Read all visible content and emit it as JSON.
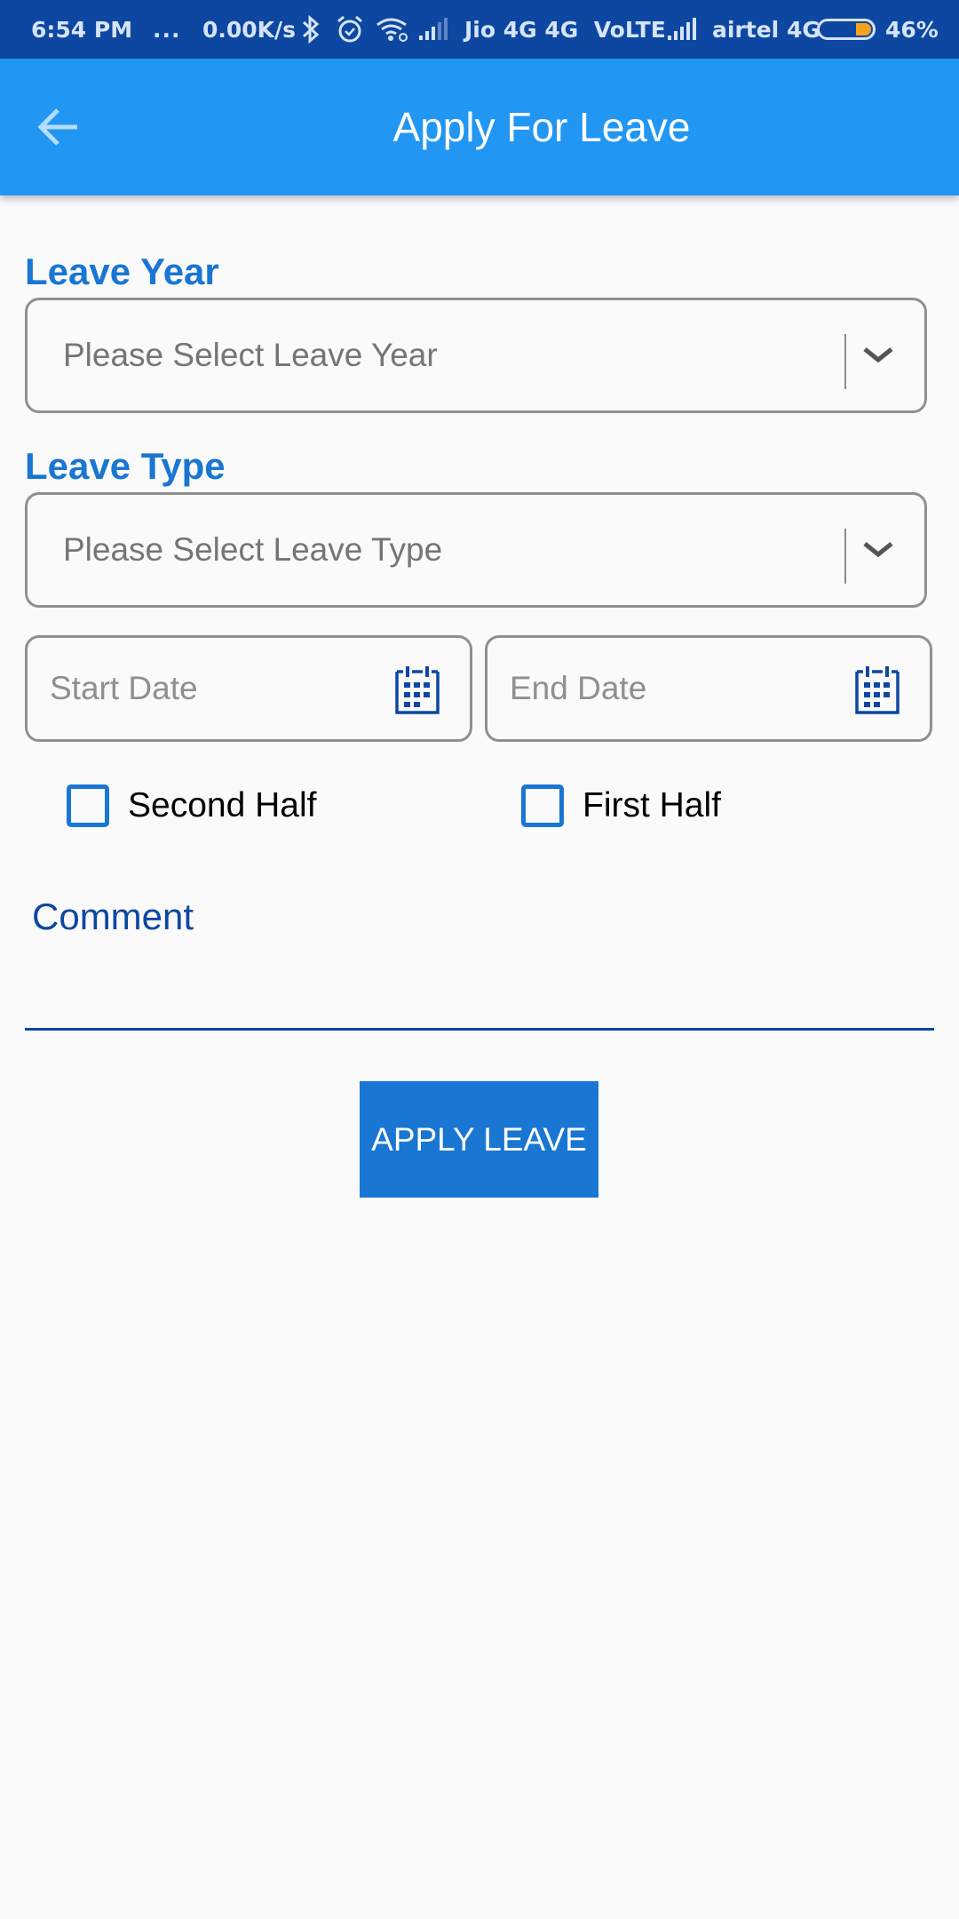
{
  "status_bar": {
    "time": "6:54 PM",
    "notifications": "...",
    "network_speed": "0.00K/s",
    "icons": [
      "bluetooth-icon",
      "alarm-icon",
      "wifi-icon",
      "signal-icon"
    ],
    "carrier1": "Jio 4G 4G  VoLTE",
    "carrier2": "airtel 4G",
    "battery_percent": "46%",
    "battery_level": 0.46,
    "battery_color": "#f7a21b"
  },
  "app_bar": {
    "title": "Apply For Leave",
    "back_icon": "arrow-left-icon",
    "color": "#2196f3"
  },
  "form": {
    "leave_year": {
      "label": "Leave Year",
      "placeholder": "Please Select Leave Year",
      "icon": "chevron-down-icon"
    },
    "leave_type": {
      "label": "Leave Type",
      "placeholder": "Please Select Leave Type",
      "icon": "chevron-down-icon"
    },
    "start_date": {
      "placeholder": "Start Date",
      "icon": "calendar-icon"
    },
    "end_date": {
      "placeholder": "End Date",
      "icon": "calendar-icon"
    },
    "checkboxes": [
      {
        "label": "Second Half",
        "checked": false
      },
      {
        "label": "First Half",
        "checked": false
      }
    ],
    "comment": {
      "label": "Comment",
      "value": ""
    },
    "submit_label": "APPLY LEAVE"
  },
  "colors": {
    "accent": "#1976d2",
    "dark_accent": "#0d47a1",
    "background": "#fafafa"
  }
}
